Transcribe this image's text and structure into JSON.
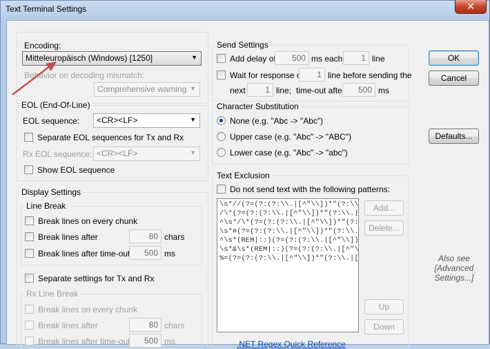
{
  "window": {
    "title": "Text Terminal Settings",
    "close_glyph": "✕"
  },
  "encoding": {
    "label": "Encoding:",
    "value": "Mitteleuropäisch (Windows) [1250]",
    "mismatch_label": "Behavior on decoding mismatch:",
    "mismatch_value": "Comprehensive warning"
  },
  "eol": {
    "group": "EOL (End-Of-Line)",
    "seq_label": "EOL sequence:",
    "seq_value": "<CR><LF>",
    "separate_label": "Separate EOL sequences for Tx and Rx",
    "rx_label": "Rx EOL sequence:",
    "rx_value": "<CR><LF>",
    "show_label": "Show EOL sequence"
  },
  "display": {
    "group": "Display Settings",
    "line_break_group": "Line Break",
    "every_chunk": "Break lines on every chunk",
    "after": "Break lines after",
    "after_value": "80",
    "chars": "chars",
    "timeout": "Break lines after time-out of",
    "timeout_value": "500",
    "ms": "ms",
    "separate": "Separate settings for Tx and Rx",
    "rx_group": "Rx Line Break",
    "rx_every_chunk": "Break lines on every chunk",
    "rx_after": "Break lines after",
    "rx_after_value": "80",
    "rx_chars": "chars",
    "rx_timeout": "Break lines after time-out of",
    "rx_timeout_value": "500",
    "rx_ms": "ms"
  },
  "send": {
    "group": "Send Settings",
    "add_delay": "Add delay of",
    "delay_value": "500",
    "ms_each": "ms each",
    "line_value": "1",
    "line": "line",
    "wait_for": "Wait for response of",
    "wait_value": "1",
    "line_before": "line before sending the",
    "next": "next",
    "next_value": "1",
    "line_semicolon": "line;",
    "timeout_after": "time-out after",
    "timeout_value": "500",
    "ms": "ms"
  },
  "substitution": {
    "group": "Character Substitution",
    "none": "None (e.g. \"Abc -> \"Abc\")",
    "upper": "Upper case (e.g. \"Abc\" -> \"ABC\")",
    "lower": "Lower case (e.g. \"Abc\" -> \"abc\")"
  },
  "exclusion": {
    "group": "Text Exclusion",
    "checkbox": "Do not send text with the following patterns:",
    "patterns": "\\s*//(?=(?:(?:\\\\.|[^\"\\\\])*\"(?:\\\\.|[^\"\\\\])*\")*(?:\n/\\*(?=(?:(?:\\\\.|[^\"\\\\])*\"(?:\\\\.|[^\"\\\\])*\")*(?:\\\n^\\s*/\\*(?=(?:(?:\\\\.|[^\"\\\\])*\"(?:\\\\.|[^\"\\\\])*\n\\s*#(?=(?:(?:\\\\.|[^\"\\\\])*\"(?:\\\\.|[^\"\\\\])*\"\n^\\s*(REM|::)(?=(?:(?:\\\\.|[^\"\\\\])*\"(?:\\\\\n\\s*&\\s*(REM|::)(?=(?:(?:\\\\.|[^\"\\\\])*\"(?:\\\\.|[^\n%=(?=(?:(?:\\\\.|[^\"\\\\])*\"(?:\\\\.|[^\"\\\\])*\")*(?:\\",
    "add": "Add...",
    "delete": "Delete...",
    "up": "Up",
    "down": "Down",
    "link": ".NET Regex Quick Reference"
  },
  "buttons": {
    "ok": "OK",
    "cancel": "Cancel",
    "defaults": "Defaults..."
  },
  "hint": {
    "line1": "Also see",
    "line2": "[Advanced",
    "line3": "Settings...]"
  },
  "colors": {
    "annotation_arrow": "#c0504d"
  }
}
